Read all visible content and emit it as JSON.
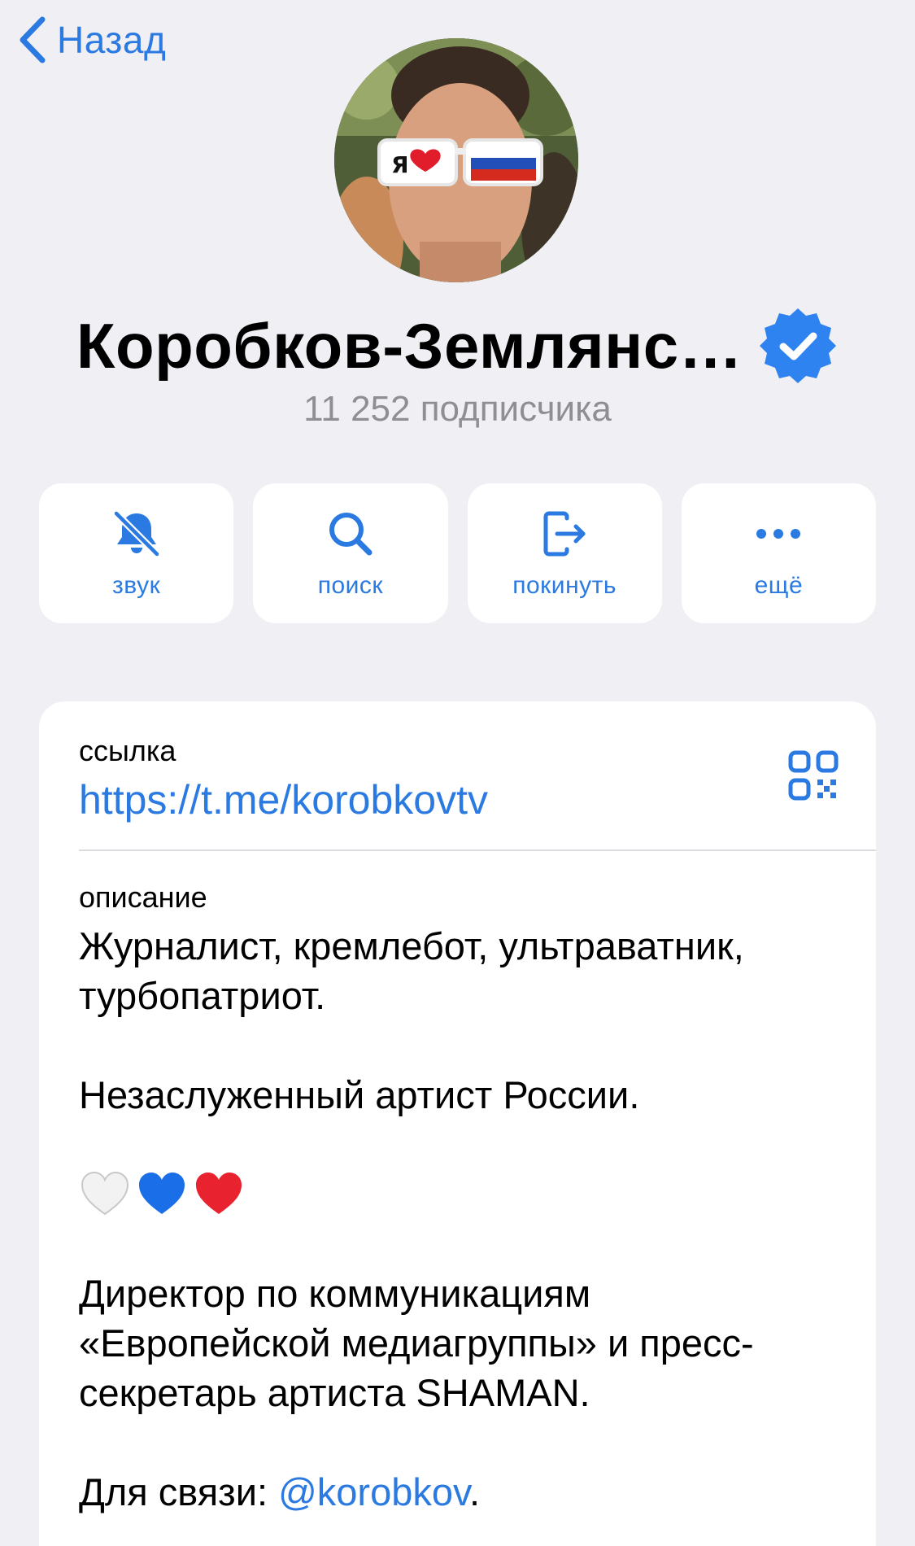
{
  "nav": {
    "back_label": "Назад"
  },
  "channel": {
    "name": "Коробков-Землянс…",
    "subscribers": "11 252 подписчика"
  },
  "actions": [
    {
      "label": "звук",
      "icon": "bell-muted-icon"
    },
    {
      "label": "поиск",
      "icon": "search-icon"
    },
    {
      "label": "покинуть",
      "icon": "leave-icon"
    },
    {
      "label": "ещё",
      "icon": "more-icon"
    }
  ],
  "info": {
    "link_label": "ссылка",
    "link_value": "https://t.me/korobkovtv",
    "description_label": "описание",
    "description_line1": "Журналист, кремлебот, ультраватник, турбопатриот.",
    "description_line2": "Незаслуженный артист России.",
    "description_line3": "Директор по коммуникациям «Европейской медиагруппы» и пресс-секретарь артиста SHAMAN.",
    "contact_prefix": "Для связи: ",
    "contact_handle": "@korobkov",
    "contact_suffix": "."
  },
  "avatar_glasses_text": "Я",
  "colors": {
    "accent": "#2a7ae2",
    "background": "#efeff4",
    "secondary_text": "#8e8e93"
  }
}
